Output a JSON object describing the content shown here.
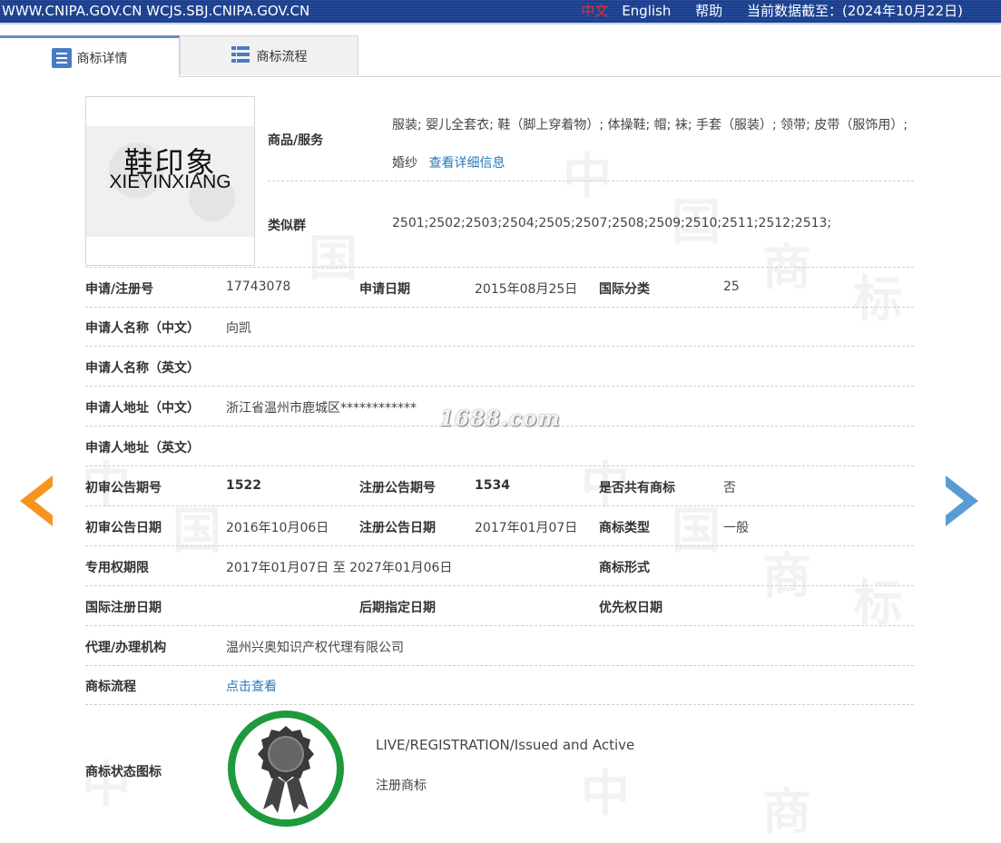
{
  "topbar": {
    "site": "WWW.CNIPA.GOV.CN WCJS.SBJ.CNIPA.GOV.CN",
    "lang_cn": "中文",
    "lang_en": "English",
    "help": "帮助",
    "data_date": "当前数据截至：(2024年10月22日)"
  },
  "tabs": {
    "detail": "商标详情",
    "flow": "商标流程"
  },
  "logo": {
    "cn": "鞋印象",
    "en": "XIEYINXIANG"
  },
  "goods": {
    "label": "商品/服务",
    "value": "服装; 婴儿全套衣; 鞋（脚上穿着物）; 体操鞋; 帽; 袜; 手套（服装）; 领带; 皮带（服饰用）; 婚纱",
    "detail_link": "查看详细信息"
  },
  "similar": {
    "label": "类似群",
    "value": "2501;2502;2503;2504;2505;2507;2508;2509;2510;2511;2512;2513;"
  },
  "fields": {
    "reg_no_label": "申请/注册号",
    "reg_no": "17743078",
    "apply_date_label": "申请日期",
    "apply_date": "2015年08月25日",
    "intl_class_label": "国际分类",
    "intl_class": "25",
    "applicant_cn_label": "申请人名称（中文）",
    "applicant_cn": "向凯",
    "applicant_en_label": "申请人名称（英文）",
    "applicant_en": "",
    "address_cn_label": "申请人地址（中文）",
    "address_cn": "浙江省温州市鹿城区************",
    "address_en_label": "申请人地址（英文）",
    "address_en": "",
    "prelim_no_label": "初审公告期号",
    "prelim_no": "1522",
    "reg_pub_no_label": "注册公告期号",
    "reg_pub_no": "1534",
    "shared_label": "是否共有商标",
    "shared": "否",
    "prelim_date_label": "初审公告日期",
    "prelim_date": "2016年10月06日",
    "reg_pub_date_label": "注册公告日期",
    "reg_pub_date": "2017年01月07日",
    "type_label": "商标类型",
    "type": "一般",
    "term_label": "专用权期限",
    "term": "2017年01月07日 至 2027年01月06日",
    "form_label": "商标形式",
    "form": "",
    "intl_reg_date_label": "国际注册日期",
    "later_date_label": "后期指定日期",
    "priority_date_label": "优先权日期",
    "agent_label": "代理/办理机构",
    "agent": "温州兴奥知识产权代理有限公司",
    "flow_label": "商标流程",
    "flow_link": "点击查看",
    "status_label": "商标状态图标",
    "status_en": "LIVE/REGISTRATION/Issued and Active",
    "status_cn": "注册商标"
  },
  "watermark": "1688.com",
  "colors": {
    "topbar": "#1a3f8f",
    "link": "#2878b8",
    "arrow_left": "#f5951f",
    "arrow_right": "#5b9bd5",
    "seal_ring": "#1e9a3c"
  }
}
